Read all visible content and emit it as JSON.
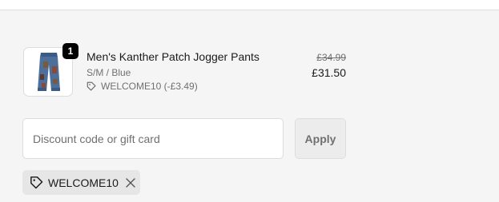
{
  "line_item": {
    "quantity": "1",
    "name": "Men's Kanther Patch Jogger Pants",
    "variant": "S/M / Blue",
    "discount": "WELCOME10 (-£3.49)",
    "compare_price": "£34.99",
    "price": "£31.50",
    "image_alt": "Men's Kanther Patch Jogger Pants"
  },
  "discount_form": {
    "placeholder": "Discount code or gift card",
    "value": "",
    "apply_label": "Apply"
  },
  "applied_code": {
    "code": "WELCOME10"
  },
  "icons": {
    "tag": "tag-icon",
    "remove": "close-icon"
  },
  "colors": {
    "background": "#f5f5f5",
    "badge": "#000000",
    "muted_text": "#707070",
    "chip_bg": "#e6e6e6"
  }
}
